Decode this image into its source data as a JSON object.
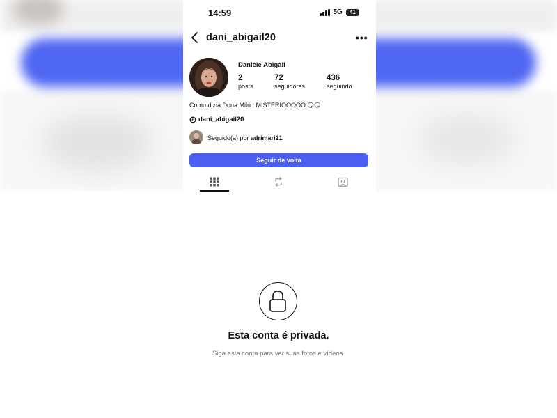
{
  "status_bar": {
    "time": "14:59",
    "network": "5G",
    "battery": "41"
  },
  "header": {
    "username": "dani_abigail20",
    "back_icon": "chevron-left-icon",
    "more_icon": "more-horizontal-icon",
    "more_glyph": "•••"
  },
  "profile": {
    "full_name": "Daniele Abigail",
    "stats": [
      {
        "value": "2",
        "label": "posts"
      },
      {
        "value": "72",
        "label": "seguidores"
      },
      {
        "value": "436",
        "label": "seguindo"
      }
    ],
    "bio": "Como dizia Dona Milú : MISTÉRIOOOOO 😏😏",
    "threads_handle": "dani_abigail20",
    "followed_by_prefix": "Seguido(a) por ",
    "followed_by_user": "adrimari21",
    "follow_button": "Seguir de volta"
  },
  "tabs": [
    {
      "name": "grid-icon",
      "selected": true
    },
    {
      "name": "reels-repost-icon",
      "selected": false
    },
    {
      "name": "tagged-icon",
      "selected": false
    }
  ],
  "private_notice": {
    "title": "Esta conta é privada.",
    "subtitle": "Siga esta conta para ver suas fotos e vídeos."
  },
  "colors": {
    "accent": "#4c5ff0",
    "background_band": "#4f67f1"
  }
}
